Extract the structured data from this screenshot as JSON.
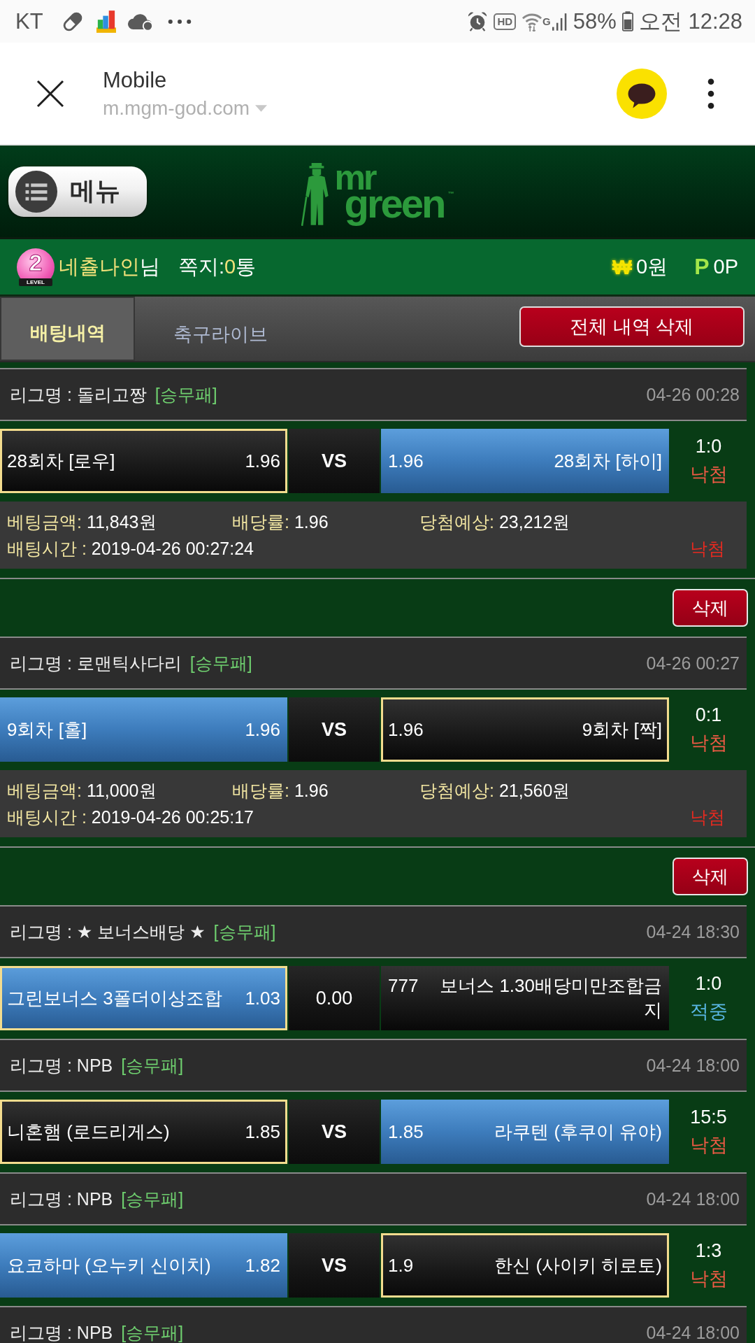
{
  "status_bar": {
    "carrier": "KT",
    "hd_label": "HD",
    "network_label": "G",
    "battery": "58%",
    "time": "오전 12:28"
  },
  "browser_bar": {
    "title": "Mobile",
    "url": "m.mgm-god.com"
  },
  "header": {
    "menu_button": "메뉴",
    "logo": {
      "line_1": "mr",
      "line_2": "green",
      "trademark": "™"
    }
  },
  "user_bar": {
    "level": "2",
    "level_label": "LEVEL",
    "user_name": "네츌나인",
    "honorific": "님",
    "messages_label": "쪽지:",
    "messages_count": "0",
    "messages_unit": "통",
    "cash_symbol": "₩",
    "cash": "0원",
    "points_symbol": "P",
    "points": "0P"
  },
  "tabs": [
    {
      "label": "배팅내역",
      "selected": true
    },
    {
      "label": "축구라이브",
      "selected": false
    }
  ],
  "delete_all_button": "전체 내역 삭제",
  "bets": [
    {
      "matches": [
        {
          "league": "리그명 : 돌리고짱",
          "bet_type": "[승무패]",
          "date": "04-26 00:28",
          "home": {
            "name": "28회차 [로우]",
            "odds": "1.96",
            "picked": false,
            "winner": true
          },
          "middle": {
            "kind": "vs",
            "text": "VS"
          },
          "away": {
            "name": "28회차 [하이]",
            "odds": "1.96",
            "picked": true,
            "winner": false
          },
          "score": "1:0",
          "outcome": "낙첨",
          "won": false
        }
      ],
      "details": {
        "amount_label": "베팅금액:",
        "amount": "11,843원",
        "rate_label": "배당률:",
        "rate": "1.96",
        "expected_label": "당첨예상:",
        "expected": "23,212원",
        "time_label": "배팅시간 :",
        "time": "2019-04-26 00:27:24",
        "outcome": "낙첨",
        "won": false
      }
    },
    {
      "delete_button": "삭제",
      "matches": [
        {
          "league": "리그명 : 로맨틱사다리",
          "bet_type": "[승무패]",
          "date": "04-26 00:27",
          "home": {
            "name": "9회차 [홀]",
            "odds": "1.96",
            "picked": true,
            "winner": false
          },
          "middle": {
            "kind": "vs",
            "text": "VS"
          },
          "away": {
            "name": "9회차 [짝]",
            "odds": "1.96",
            "picked": false,
            "winner": true
          },
          "score": "0:1",
          "outcome": "낙첨",
          "won": false
        }
      ],
      "details": {
        "amount_label": "베팅금액:",
        "amount": "11,000원",
        "rate_label": "배당률:",
        "rate": "1.96",
        "expected_label": "당첨예상:",
        "expected": "21,560원",
        "time_label": "배팅시간 :",
        "time": "2019-04-26 00:25:17",
        "outcome": "낙첨",
        "won": false
      }
    },
    {
      "delete_button": "삭제",
      "matches": [
        {
          "league": "리그명 : ★ 보너스배당 ★",
          "bet_type": "[승무패]",
          "date": "04-24 18:30",
          "home": {
            "name": "그린보너스 3폴더이상조합",
            "odds": "1.03",
            "picked": true,
            "winner": true
          },
          "middle": {
            "kind": "odds",
            "text": "0.00"
          },
          "away": {
            "name": "보너스 1.30배당미만조합금지",
            "odds": "777",
            "picked": false,
            "winner": false
          },
          "score": "1:0",
          "outcome": "적중",
          "won": true
        },
        {
          "league": "리그명 : NPB",
          "bet_type": "[승무패]",
          "date": "04-24 18:00",
          "home": {
            "name": "니혼햄 (로드리게스)",
            "odds": "1.85",
            "picked": false,
            "winner": true
          },
          "middle": {
            "kind": "vs",
            "text": "VS"
          },
          "away": {
            "name": "라쿠텐 (후쿠이 유야)",
            "odds": "1.85",
            "picked": true,
            "winner": false
          },
          "score": "15:5",
          "outcome": "낙첨",
          "won": false
        },
        {
          "league": "리그명 : NPB",
          "bet_type": "[승무패]",
          "date": "04-24 18:00",
          "home": {
            "name": "요코하마 (오누키 신이치)",
            "odds": "1.82",
            "picked": true,
            "winner": false
          },
          "middle": {
            "kind": "vs",
            "text": "VS"
          },
          "away": {
            "name": "한신 (사이키 히로토)",
            "odds": "1.9",
            "picked": false,
            "winner": true
          },
          "score": "1:3",
          "outcome": "낙첨",
          "won": false
        },
        {
          "league": "리그명 : NPB",
          "bet_type": "[승무패]",
          "date": "04-24 18:00"
        }
      ]
    }
  ]
}
